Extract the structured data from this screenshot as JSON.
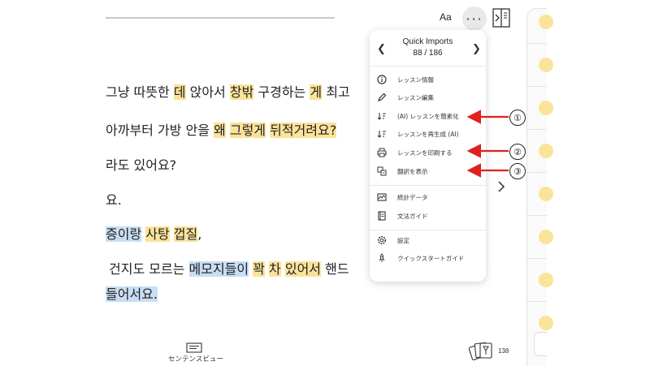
{
  "toolbar": {
    "font_label": "Aa",
    "more_label": "···"
  },
  "reading": {
    "lines": [
      {
        "segments": [
          {
            "t": "그냥 따뜻한 ",
            "h": ""
          },
          {
            "t": "데",
            "h": "y"
          },
          {
            "t": " 앉아서 ",
            "h": ""
          },
          {
            "t": "창밖",
            "h": "y"
          },
          {
            "t": " 구경하는 ",
            "h": ""
          },
          {
            "t": "게",
            "h": "y"
          },
          {
            "t": " 최고",
            "h": ""
          }
        ]
      },
      {
        "segments": [
          {
            "t": "아까부터 가방 안을 ",
            "h": ""
          },
          {
            "t": "왜",
            "h": "y"
          },
          {
            "t": " ",
            "h": ""
          },
          {
            "t": "그렇게",
            "h": "y"
          },
          {
            "t": " ",
            "h": ""
          },
          {
            "t": "뒤적거려요?",
            "h": "y"
          }
        ]
      },
      {
        "segments": [
          {
            "t": "라도 있어요?",
            "h": ""
          }
        ]
      },
      {
        "segments": [
          {
            "t": "요.",
            "h": ""
          }
        ]
      },
      {
        "segments": [
          {
            "t": "증이랑",
            "h": "b"
          },
          {
            "t": " ",
            "h": ""
          },
          {
            "t": "사탕",
            "h": "y"
          },
          {
            "t": " ",
            "h": ""
          },
          {
            "t": "껍질",
            "h": "y"
          },
          {
            "t": ",",
            "h": ""
          }
        ]
      },
      {
        "segments": [
          {
            "t": "건지도 모르는 ",
            "h": ""
          },
          {
            "t": "메모지들이",
            "h": "b"
          },
          {
            "t": " ",
            "h": ""
          },
          {
            "t": "꽉",
            "h": "y"
          },
          {
            "t": " ",
            "h": ""
          },
          {
            "t": "차",
            "h": "y"
          },
          {
            "t": " ",
            "h": ""
          },
          {
            "t": "있어서",
            "h": "y"
          },
          {
            "t": " 핸드",
            "h": ""
          }
        ]
      },
      {
        "segments": [
          {
            "t": "들어서요.",
            "h": "b"
          }
        ]
      }
    ]
  },
  "menu": {
    "title": "Quick Imports",
    "page": "88 / 186",
    "items": [
      {
        "label": "レッスン情報",
        "icon": "info-icon"
      },
      {
        "label": "レッスン編集",
        "icon": "pencil-icon"
      },
      {
        "label": "(AI) レッスンを簡素化",
        "icon": "sort-icon"
      },
      {
        "label": "レッスンを再生成 (AI)",
        "icon": "sort-icon"
      },
      {
        "label": "レッスンを印刷する",
        "icon": "printer-icon"
      },
      {
        "label": "翻訳を表示",
        "icon": "translate-icon"
      },
      {
        "label": "統計データ",
        "icon": "stats-icon"
      },
      {
        "label": "文法ガイド",
        "icon": "book-icon"
      },
      {
        "label": "設定",
        "icon": "gear-icon"
      },
      {
        "label": "クイックスタートガイド",
        "icon": "rocket-icon"
      }
    ]
  },
  "callouts": [
    "①",
    "②",
    "③"
  ],
  "bottom": {
    "sentence_view_label": "センテンスビュー",
    "card_count": "138"
  },
  "colors": {
    "highlight_yellow": "#fbe39a",
    "highlight_blue": "#c9def5",
    "arrow_red": "#e02020"
  }
}
